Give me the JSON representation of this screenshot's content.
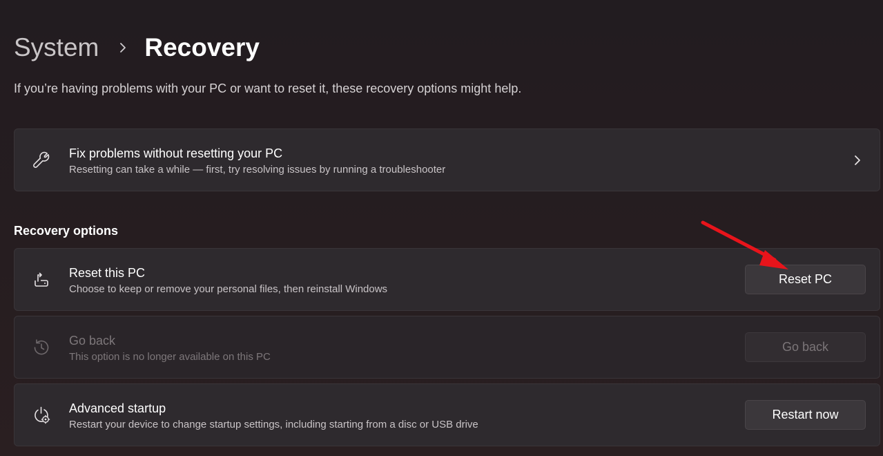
{
  "breadcrumb": {
    "parent": "System",
    "current": "Recovery"
  },
  "description": "If you’re having problems with your PC or want to reset it, these recovery options might help.",
  "fix_card": {
    "icon": "wrench-icon",
    "title": "Fix problems without resetting your PC",
    "subtitle": "Resetting can take a while — first, try resolving issues by running a troubleshooter"
  },
  "section": {
    "title": "Recovery options"
  },
  "options": {
    "reset": {
      "icon": "reset-pc-icon",
      "title": "Reset this PC",
      "subtitle": "Choose to keep or remove your personal files, then reinstall Windows",
      "button": "Reset PC"
    },
    "goback": {
      "icon": "history-icon",
      "title": "Go back",
      "subtitle": "This option is no longer available on this PC",
      "button": "Go back"
    },
    "advanced": {
      "icon": "advanced-startup-icon",
      "title": "Advanced startup",
      "subtitle": "Restart your device to change startup settings, including starting from a disc or USB drive",
      "button": "Restart now"
    }
  },
  "colors": {
    "annotation_arrow": "#e8141b",
    "background": "#241c20",
    "card": "#2e2a2e"
  }
}
